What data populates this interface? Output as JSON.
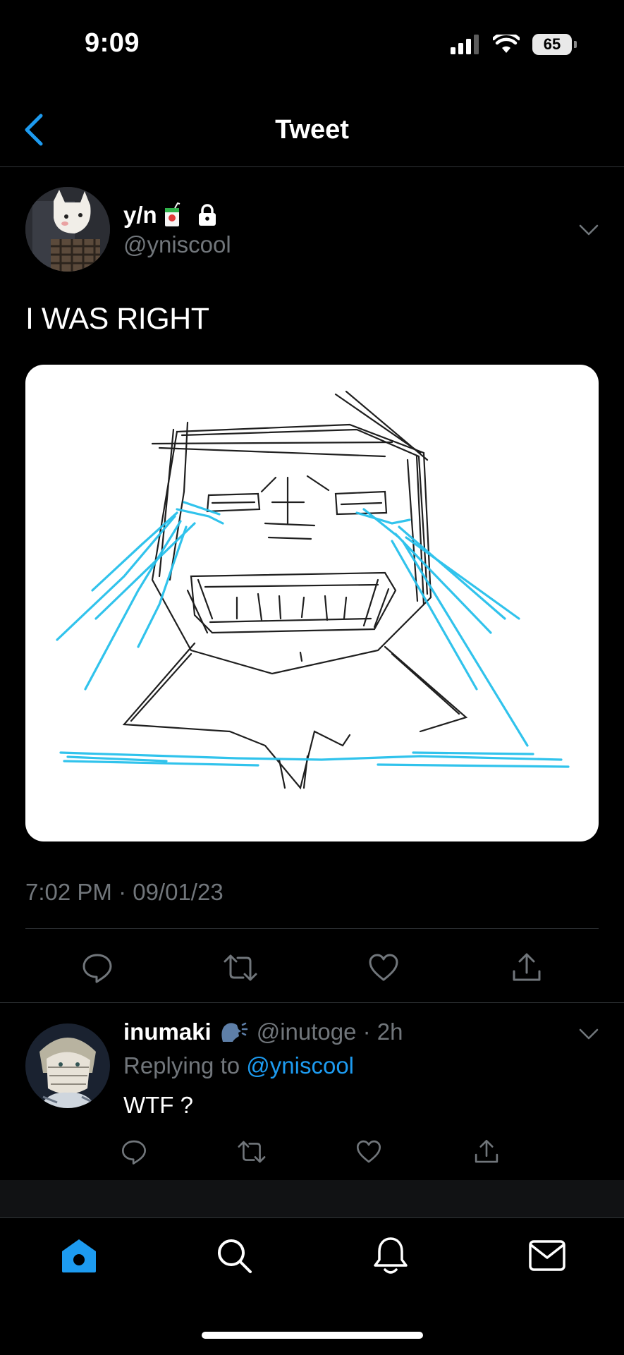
{
  "status_bar": {
    "time": "9:09",
    "battery": "65"
  },
  "header": {
    "title": "Tweet"
  },
  "tweet": {
    "display_name": "y/n",
    "handle": "@yniscool",
    "text": "I WAS RIGHT",
    "timestamp": "7:02 PM · 09/01/23"
  },
  "reply": {
    "display_name": "inumaki",
    "handle_time": "@inutoge · 2h",
    "replying_prefix": "Replying to",
    "replying_to": "@yniscool",
    "text": "WTF ?"
  },
  "icons": {
    "back": "chevron-left-icon",
    "reply": "comment-icon",
    "retweet": "retweet-icon",
    "like": "heart-icon",
    "share": "share-icon",
    "home": "home-icon",
    "search": "search-icon",
    "notifications": "bell-icon",
    "messages": "mail-icon"
  },
  "colors": {
    "accent": "#1d9bf0",
    "secondary_text": "#71767b",
    "divider": "#2f3336"
  }
}
